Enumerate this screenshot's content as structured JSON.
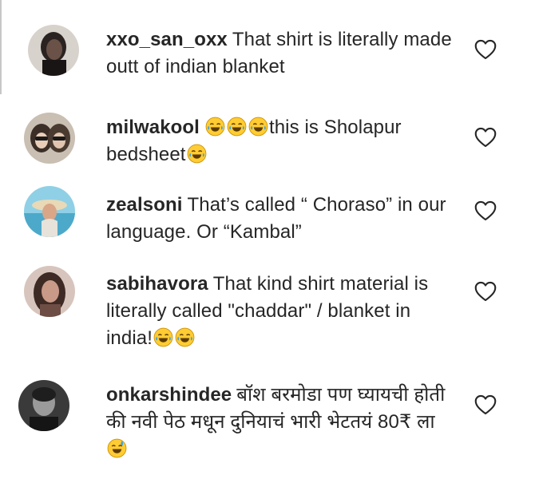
{
  "comments": [
    {
      "username": "xxo_san_oxx",
      "text": "That shirt is literally made outt of indian blanket",
      "avatar_color": "#3a302c",
      "like_icon": "heart-outline-icon"
    },
    {
      "username": "milwakool",
      "emoji_pre": [
        "joy-emoji",
        "joy-emoji",
        "joy-emoji"
      ],
      "text": "this is Sholapur bedsheet",
      "emoji_post": [
        "joy-emoji"
      ],
      "avatar_color": "#5a4a40",
      "like_icon": "heart-outline-icon"
    },
    {
      "username": "zealsoni",
      "text": "That’s called “ Choraso” in our language. Or “Kambal”",
      "avatar_color": "#7fc1d6",
      "like_icon": "heart-outline-icon"
    },
    {
      "username": "sabihavora",
      "text": "That kind shirt material is literally called \"chaddar\" / blanket in india!",
      "emoji_post": [
        "joy-emoji",
        "joy-emoji"
      ],
      "avatar_color": "#b58a7e",
      "like_icon": "heart-outline-icon"
    },
    {
      "username": "onkarshindee",
      "text": "बॉश बरमोडा पण घ्यायची होती की नवी पेठ मधून दुनियाचं भारी भेटतयं 80₹ ला",
      "emoji_post": [
        "sweat-smile-emoji"
      ],
      "avatar_color": "#2b2b2b",
      "like_icon": "heart-outline-icon"
    }
  ],
  "colors": {
    "text": "#262626",
    "heart_stroke": "#262626",
    "emoji_face": "#ffcc33",
    "emoji_tear": "#3fa4e6"
  }
}
